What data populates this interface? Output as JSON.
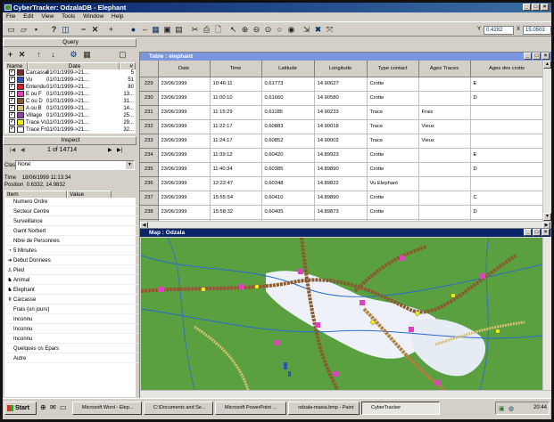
{
  "app": {
    "title": "CyberTracker: OdzalaDB - Elephant"
  },
  "menu": [
    "File",
    "Edit",
    "View",
    "Tools",
    "Window",
    "Help"
  ],
  "toolbar": {
    "y_value": "0.4282",
    "x_value": "15.0503"
  },
  "query": {
    "title": "Query",
    "columns": [
      "Name",
      "Date",
      "#"
    ],
    "rows": [
      {
        "name": "Carcasse",
        "date": "01/01/1999->21...",
        "count": "5",
        "color": "#7a2a2a",
        "checked": true
      },
      {
        "name": "Vu",
        "date": "01/01/1999->21...",
        "count": "51",
        "color": "#3050c8",
        "checked": true
      },
      {
        "name": "Entendu",
        "date": "01/01/1999->21...",
        "count": "80",
        "color": "#d02020",
        "checked": true
      },
      {
        "name": "E ou F",
        "date": "01/01/1999->21...",
        "count": "13...",
        "color": "#e040c0",
        "checked": true
      },
      {
        "name": "C ou D",
        "date": "01/01/1999->21...",
        "count": "31...",
        "color": "#8a5a30",
        "checked": true
      },
      {
        "name": "A ou B",
        "date": "01/01/1999->21...",
        "count": "14...",
        "color": "#d8c070",
        "checked": true
      },
      {
        "name": "Village",
        "date": "01/01/1999->21...",
        "count": "25...",
        "color": "#9040a0",
        "checked": true
      },
      {
        "name": "Trace Vi...",
        "date": "01/01/1999->21...",
        "count": "29...",
        "color": "#f0f000",
        "checked": true
      },
      {
        "name": "Trace Fr...",
        "date": "01/01/1999->21...",
        "count": "32...",
        "color": "#ffffff",
        "checked": true
      }
    ]
  },
  "inspect": {
    "title": "Inspect",
    "counter": "1 of 14714",
    "class_label": "Class",
    "class_value": "None",
    "time": "Time    18/06/1999 11:13:34",
    "position": "Position  0.6332, 14.9832",
    "columns": [
      "Item",
      "Value"
    ],
    "items": [
      {
        "icon": "",
        "label": "Numero Ordre"
      },
      {
        "icon": "",
        "label": "Secteur Centre"
      },
      {
        "icon": "",
        "label": "Surveillance"
      },
      {
        "icon": "",
        "label": "Gamt Norbert"
      },
      {
        "icon": "",
        "label": "Nbre de Personnes"
      },
      {
        "icon": "clock",
        "label": "5 Minutes"
      },
      {
        "icon": "arrow",
        "label": "Debut Donnees"
      },
      {
        "icon": "foot",
        "label": "Pied"
      },
      {
        "icon": "animal",
        "label": "Animal"
      },
      {
        "icon": "elephant",
        "label": "Elephant"
      },
      {
        "icon": "carcass",
        "label": "Carcasse"
      },
      {
        "icon": "",
        "label": "Frais (un jours)"
      },
      {
        "icon": "",
        "label": "Inconnu"
      },
      {
        "icon": "",
        "label": "Inconnu"
      },
      {
        "icon": "",
        "label": "Inconnu"
      },
      {
        "icon": "",
        "label": "Quelques os Epars"
      },
      {
        "icon": "",
        "label": "Autre"
      }
    ]
  },
  "table": {
    "title": "Table : elephant",
    "columns": [
      "Date",
      "Time",
      "Latitude",
      "Longitude",
      "Type contact",
      "Ages Traces",
      "Ages des crotts"
    ],
    "rows": [
      {
        "n": "229",
        "date": "23/06/1999",
        "time": "10:46:11",
        "lat": "0.61773",
        "lon": "14.90627",
        "type": "Crotte",
        "ages": "",
        "agec": "E"
      },
      {
        "n": "230",
        "date": "23/06/1999",
        "time": "11:00:10",
        "lat": "0.61660",
        "lon": "14.90580",
        "type": "Crotte",
        "ages": "",
        "agec": "D"
      },
      {
        "n": "231",
        "date": "23/06/1999",
        "time": "11:15:29",
        "lat": "0.61185",
        "lon": "14.90233",
        "type": "Trace",
        "ages": "Frais",
        "agec": ""
      },
      {
        "n": "232",
        "date": "23/06/1999",
        "time": "11:22:17",
        "lat": "0.60883",
        "lon": "14.90018",
        "type": "Trace",
        "ages": "Vieux",
        "agec": ""
      },
      {
        "n": "233",
        "date": "23/06/1999",
        "time": "11:24:17",
        "lat": "0.60852",
        "lon": "14.90002",
        "type": "Trace",
        "ages": "Vieux",
        "agec": ""
      },
      {
        "n": "234",
        "date": "23/06/1999",
        "time": "11:39:12",
        "lat": "0.60420",
        "lon": "14.89923",
        "type": "Crotte",
        "ages": "",
        "agec": "E"
      },
      {
        "n": "235",
        "date": "23/06/1999",
        "time": "11:40:34",
        "lat": "0.60385",
        "lon": "14.89890",
        "type": "Crotte",
        "ages": "",
        "agec": "D"
      },
      {
        "n": "236",
        "date": "23/06/1999",
        "time": "12:22:47",
        "lat": "0.60348",
        "lon": "14.89822",
        "type": "Vu Elephant",
        "ages": "",
        "agec": ""
      },
      {
        "n": "237",
        "date": "23/06/1999",
        "time": "15:55:54",
        "lat": "0.60410",
        "lon": "14.89890",
        "type": "Crotte",
        "ages": "",
        "agec": "C"
      },
      {
        "n": "238",
        "date": "23/06/1999",
        "time": "15:58:32",
        "lat": "0.60405",
        "lon": "14.89873",
        "type": "Crotte",
        "ages": "",
        "agec": "D"
      },
      {
        "n": "239",
        "date": "23/06/1999",
        "time": "16:07:49",
        "lat": "0.60730",
        "lon": "14.89922",
        "type": "Trace",
        "ages": "Vieux",
        "agec": ""
      }
    ]
  },
  "map": {
    "title": "Map : Odzala"
  },
  "taskbar": {
    "start": "Start",
    "tasks": [
      "Microsoft Word - Elep...",
      "C:\\Documents and Se...",
      "Microsoft PowerPoint ...",
      "odzala-maxia.bmp - Paint",
      "CyberTracker"
    ],
    "clock": "20:44"
  },
  "colors": {
    "titlebar": "#0a246a",
    "table_title": "#7a96df",
    "face": "#d4d0c8"
  }
}
